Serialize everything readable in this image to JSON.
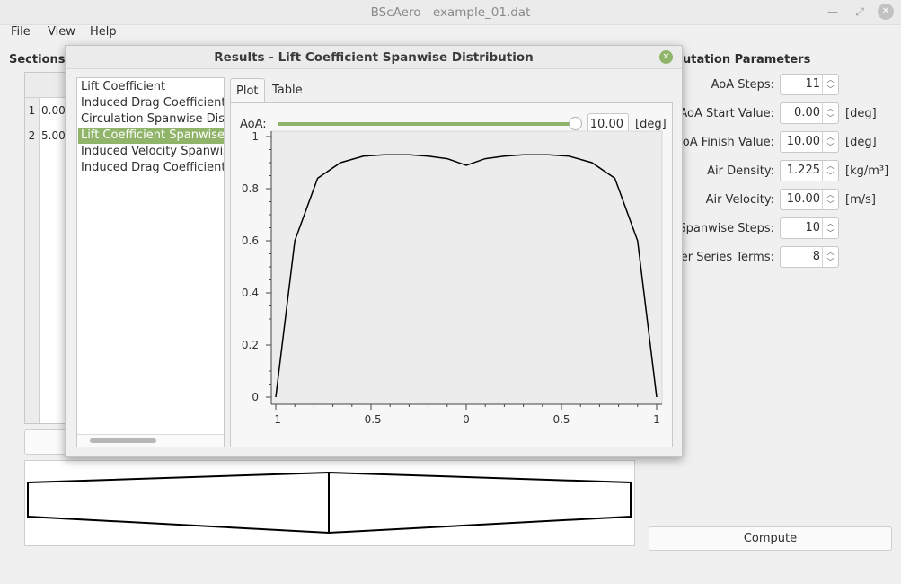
{
  "window": {
    "title": "BScAero - example_01.dat"
  },
  "menu": {
    "file": "File",
    "view": "View",
    "help": "Help"
  },
  "sections": {
    "title": "Sections D",
    "rows": [
      {
        "num": "1",
        "value": "0.00"
      },
      {
        "num": "2",
        "value": "5.00"
      }
    ]
  },
  "computation": {
    "title": "utation Parameters",
    "params": [
      {
        "label": "AoA Steps:",
        "value": "11",
        "unit": ""
      },
      {
        "label": "AoA Start Value:",
        "value": "0.00",
        "unit": "[deg]"
      },
      {
        "label": "AoA Finish Value:",
        "value": "10.00",
        "unit": "[deg]"
      },
      {
        "label": "Air Density:",
        "value": "1.225",
        "unit": "[kg/m³]"
      },
      {
        "label": "Air Velocity:",
        "value": "10.00",
        "unit": "[m/s]"
      },
      {
        "label": "Spanwise Steps:",
        "value": "10",
        "unit": ""
      },
      {
        "label": "rier Series Terms:",
        "value": "8",
        "unit": ""
      }
    ],
    "compute_label": "Compute"
  },
  "dialog": {
    "title": "Results - Lift Coefficient Spanwise Distribution",
    "list": [
      "Lift Coefficient",
      "Induced Drag Coefficient",
      "Circulation Spanwise Distribution",
      "Lift Coefficient Spanwise Distribution",
      "Induced Velocity Spanwise Distribution",
      "Induced Drag Coefficient Spanwise Distribution"
    ],
    "selected_index": 3,
    "tabs": {
      "plot": "Plot",
      "table": "Table"
    },
    "aoa": {
      "label": "AoA:",
      "value": "10.00",
      "unit": "[deg]",
      "fraction": 1.0
    }
  },
  "colors": {
    "accent": "#8fb46a"
  },
  "chart_data": {
    "type": "line",
    "x": [
      -1.0,
      -0.9,
      -0.78,
      -0.66,
      -0.54,
      -0.43,
      -0.3,
      -0.2,
      -0.1,
      0.0,
      0.1,
      0.2,
      0.3,
      0.43,
      0.54,
      0.66,
      0.78,
      0.9,
      1.0
    ],
    "y": [
      0.0,
      0.6,
      0.84,
      0.9,
      0.925,
      0.93,
      0.93,
      0.925,
      0.915,
      0.89,
      0.915,
      0.925,
      0.93,
      0.93,
      0.925,
      0.9,
      0.84,
      0.6,
      0.0
    ],
    "xlim": [
      -1,
      1
    ],
    "ylim": [
      0,
      1
    ],
    "xticks": [
      "-1",
      "-0.5",
      "0",
      "0.5",
      "1"
    ],
    "yticks": [
      "0",
      "0.2",
      "0.4",
      "0.6",
      "0.8",
      "1"
    ],
    "grid": false
  }
}
